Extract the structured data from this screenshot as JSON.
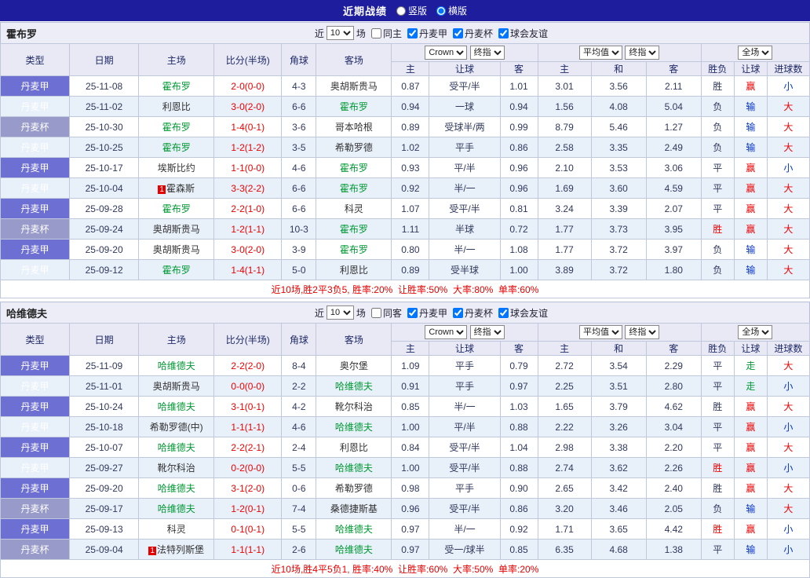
{
  "topbar": {
    "title": "近期战绩",
    "options": [
      {
        "label": "竖版",
        "checked": false
      },
      {
        "label": "横版",
        "checked": true
      }
    ]
  },
  "columns": [
    "类型",
    "日期",
    "主场",
    "比分(半场)",
    "角球",
    "客场",
    "主",
    "让球",
    "客",
    "主",
    "和",
    "客",
    "胜负",
    "让球",
    "进球数"
  ],
  "tables": [
    {
      "team": "霍布罗",
      "filters": {
        "near": "近",
        "count": "10",
        "games": "场",
        "venue": {
          "label": "同主",
          "checked": false
        },
        "comps": [
          {
            "label": "丹麦甲",
            "checked": true
          },
          {
            "label": "丹麦杯",
            "checked": true
          },
          {
            "label": "球会友谊",
            "checked": true
          }
        ]
      },
      "selects": {
        "odds_company": "Crown",
        "odds_time": "终指",
        "euro_company": "平均值",
        "euro_time": "终指",
        "scope": "全场"
      },
      "rows": [
        {
          "type": "丹麦甲",
          "cup": false,
          "date": "25-11-08",
          "home": "霍布罗",
          "hf": true,
          "hb": "",
          "score": "2-0(0-0)",
          "corner": "4-3",
          "away": "奥胡斯贵马",
          "af": false,
          "ab": "",
          "odds": [
            "0.87",
            "受平/半",
            "1.01",
            "3.01",
            "3.56",
            "2.11"
          ],
          "res": "胜",
          "resc": "navy",
          "let": "赢",
          "letc": "red",
          "goal": "小",
          "goalc": "blue"
        },
        {
          "type": "丹麦甲",
          "cup": false,
          "date": "25-11-02",
          "home": "利恩比",
          "hf": false,
          "hb": "",
          "score": "3-0(2-0)",
          "corner": "6-6",
          "away": "霍布罗",
          "af": true,
          "ab": "",
          "odds": [
            "0.94",
            "一球",
            "0.94",
            "1.56",
            "4.08",
            "5.04"
          ],
          "res": "负",
          "resc": "navy",
          "let": "输",
          "letc": "blue",
          "goal": "大",
          "goalc": "red"
        },
        {
          "type": "丹麦杯",
          "cup": true,
          "date": "25-10-30",
          "home": "霍布罗",
          "hf": true,
          "hb": "",
          "score": "1-4(0-1)",
          "corner": "3-6",
          "away": "哥本哈根",
          "af": false,
          "ab": "",
          "odds": [
            "0.89",
            "受球半/两",
            "0.99",
            "8.79",
            "5.46",
            "1.27"
          ],
          "res": "负",
          "resc": "navy",
          "let": "输",
          "letc": "blue",
          "goal": "大",
          "goalc": "red"
        },
        {
          "type": "丹麦甲",
          "cup": false,
          "date": "25-10-25",
          "home": "霍布罗",
          "hf": true,
          "hb": "",
          "score": "1-2(1-2)",
          "corner": "3-5",
          "away": "希勒罗德",
          "af": false,
          "ab": "",
          "odds": [
            "1.02",
            "平手",
            "0.86",
            "2.58",
            "3.35",
            "2.49"
          ],
          "res": "负",
          "resc": "navy",
          "let": "输",
          "letc": "blue",
          "goal": "大",
          "goalc": "red"
        },
        {
          "type": "丹麦甲",
          "cup": false,
          "date": "25-10-17",
          "home": "埃斯比约",
          "hf": false,
          "hb": "",
          "score": "1-1(0-0)",
          "corner": "4-6",
          "away": "霍布罗",
          "af": true,
          "ab": "",
          "odds": [
            "0.93",
            "平/半",
            "0.96",
            "2.10",
            "3.53",
            "3.06"
          ],
          "res": "平",
          "resc": "navy",
          "let": "赢",
          "letc": "red",
          "goal": "小",
          "goalc": "blue"
        },
        {
          "type": "丹麦甲",
          "cup": false,
          "date": "25-10-04",
          "home": "霍森斯",
          "hf": false,
          "hb": "1",
          "score": "3-3(2-2)",
          "corner": "6-6",
          "away": "霍布罗",
          "af": true,
          "ab": "",
          "odds": [
            "0.92",
            "半/一",
            "0.96",
            "1.69",
            "3.60",
            "4.59"
          ],
          "res": "平",
          "resc": "navy",
          "let": "赢",
          "letc": "red",
          "goal": "大",
          "goalc": "red"
        },
        {
          "type": "丹麦甲",
          "cup": false,
          "date": "25-09-28",
          "home": "霍布罗",
          "hf": true,
          "hb": "",
          "score": "2-2(1-0)",
          "corner": "6-6",
          "away": "科灵",
          "af": false,
          "ab": "",
          "odds": [
            "1.07",
            "受平/半",
            "0.81",
            "3.24",
            "3.39",
            "2.07"
          ],
          "res": "平",
          "resc": "navy",
          "let": "赢",
          "letc": "red",
          "goal": "大",
          "goalc": "red"
        },
        {
          "type": "丹麦杯",
          "cup": true,
          "date": "25-09-24",
          "home": "奥胡斯贵马",
          "hf": false,
          "hb": "",
          "score": "1-2(1-1)",
          "corner": "10-3",
          "away": "霍布罗",
          "af": true,
          "ab": "",
          "odds": [
            "1.11",
            "半球",
            "0.72",
            "1.77",
            "3.73",
            "3.95"
          ],
          "res": "胜",
          "resc": "red",
          "let": "赢",
          "letc": "red",
          "goal": "大",
          "goalc": "red"
        },
        {
          "type": "丹麦甲",
          "cup": false,
          "date": "25-09-20",
          "home": "奥胡斯贵马",
          "hf": false,
          "hb": "",
          "score": "3-0(2-0)",
          "corner": "3-9",
          "away": "霍布罗",
          "af": true,
          "ab": "",
          "odds": [
            "0.80",
            "半/一",
            "1.08",
            "1.77",
            "3.72",
            "3.97"
          ],
          "res": "负",
          "resc": "navy",
          "let": "输",
          "letc": "blue",
          "goal": "大",
          "goalc": "red"
        },
        {
          "type": "丹麦甲",
          "cup": false,
          "date": "25-09-12",
          "home": "霍布罗",
          "hf": true,
          "hb": "",
          "score": "1-4(1-1)",
          "corner": "5-0",
          "away": "利恩比",
          "af": false,
          "ab": "",
          "odds": [
            "0.89",
            "受半球",
            "1.00",
            "3.89",
            "3.72",
            "1.80"
          ],
          "res": "负",
          "resc": "navy",
          "let": "输",
          "letc": "blue",
          "goal": "大",
          "goalc": "red"
        }
      ],
      "summary": "近10场,胜2平3负5, 胜率:20%  让胜率:50%  大率:80%  单率:60%"
    },
    {
      "team": "哈维德夫",
      "filters": {
        "near": "近",
        "count": "10",
        "games": "场",
        "venue": {
          "label": "同客",
          "checked": false
        },
        "comps": [
          {
            "label": "丹麦甲",
            "checked": true
          },
          {
            "label": "丹麦杯",
            "checked": true
          },
          {
            "label": "球会友谊",
            "checked": true
          }
        ]
      },
      "selects": {
        "odds_company": "Crown",
        "odds_time": "终指",
        "euro_company": "平均值",
        "euro_time": "终指",
        "scope": "全场"
      },
      "rows": [
        {
          "type": "丹麦甲",
          "cup": false,
          "date": "25-11-09",
          "home": "哈维德夫",
          "hf": true,
          "hb": "",
          "score": "2-2(2-0)",
          "corner": "8-4",
          "away": "奥尔堡",
          "af": false,
          "ab": "",
          "odds": [
            "1.09",
            "平手",
            "0.79",
            "2.72",
            "3.54",
            "2.29"
          ],
          "res": "平",
          "resc": "navy",
          "let": "走",
          "letc": "green",
          "goal": "大",
          "goalc": "red"
        },
        {
          "type": "丹麦甲",
          "cup": false,
          "date": "25-11-01",
          "home": "奥胡斯贵马",
          "hf": false,
          "hb": "",
          "score": "0-0(0-0)",
          "corner": "2-2",
          "away": "哈维德夫",
          "af": true,
          "ab": "",
          "odds": [
            "0.91",
            "平手",
            "0.97",
            "2.25",
            "3.51",
            "2.80"
          ],
          "res": "平",
          "resc": "navy",
          "let": "走",
          "letc": "green",
          "goal": "小",
          "goalc": "blue"
        },
        {
          "type": "丹麦甲",
          "cup": false,
          "date": "25-10-24",
          "home": "哈维德夫",
          "hf": true,
          "hb": "",
          "score": "3-1(0-1)",
          "corner": "4-2",
          "away": "靴尔科治",
          "af": false,
          "ab": "",
          "odds": [
            "0.85",
            "半/一",
            "1.03",
            "1.65",
            "3.79",
            "4.62"
          ],
          "res": "胜",
          "resc": "navy",
          "let": "赢",
          "letc": "red",
          "goal": "大",
          "goalc": "red"
        },
        {
          "type": "丹麦甲",
          "cup": false,
          "date": "25-10-18",
          "home": "希勒罗德(中)",
          "hf": false,
          "hb": "",
          "score": "1-1(1-1)",
          "corner": "4-6",
          "away": "哈维德夫",
          "af": true,
          "ab": "",
          "odds": [
            "1.00",
            "平/半",
            "0.88",
            "2.22",
            "3.26",
            "3.04"
          ],
          "res": "平",
          "resc": "navy",
          "let": "赢",
          "letc": "red",
          "goal": "小",
          "goalc": "blue"
        },
        {
          "type": "丹麦甲",
          "cup": false,
          "date": "25-10-07",
          "home": "哈维德夫",
          "hf": true,
          "hb": "",
          "score": "2-2(2-1)",
          "corner": "2-4",
          "away": "利恩比",
          "af": false,
          "ab": "",
          "odds": [
            "0.84",
            "受平/半",
            "1.04",
            "2.98",
            "3.38",
            "2.20"
          ],
          "res": "平",
          "resc": "navy",
          "let": "赢",
          "letc": "red",
          "goal": "大",
          "goalc": "red"
        },
        {
          "type": "丹麦甲",
          "cup": false,
          "date": "25-09-27",
          "home": "靴尔科治",
          "hf": false,
          "hb": "",
          "score": "0-2(0-0)",
          "corner": "5-5",
          "away": "哈维德夫",
          "af": true,
          "ab": "",
          "odds": [
            "1.00",
            "受平/半",
            "0.88",
            "2.74",
            "3.62",
            "2.26"
          ],
          "res": "胜",
          "resc": "red",
          "let": "赢",
          "letc": "red",
          "goal": "小",
          "goalc": "blue"
        },
        {
          "type": "丹麦甲",
          "cup": false,
          "date": "25-09-20",
          "home": "哈维德夫",
          "hf": true,
          "hb": "",
          "score": "3-1(2-0)",
          "corner": "0-6",
          "away": "希勒罗德",
          "af": false,
          "ab": "",
          "odds": [
            "0.98",
            "平手",
            "0.90",
            "2.65",
            "3.42",
            "2.40"
          ],
          "res": "胜",
          "resc": "navy",
          "let": "赢",
          "letc": "red",
          "goal": "大",
          "goalc": "red"
        },
        {
          "type": "丹麦杯",
          "cup": true,
          "date": "25-09-17",
          "home": "哈维德夫",
          "hf": true,
          "hb": "",
          "score": "1-2(0-1)",
          "corner": "7-4",
          "away": "桑德捷斯基",
          "af": false,
          "ab": "",
          "odds": [
            "0.96",
            "受平/半",
            "0.86",
            "3.20",
            "3.46",
            "2.05"
          ],
          "res": "负",
          "resc": "navy",
          "let": "输",
          "letc": "blue",
          "goal": "大",
          "goalc": "red"
        },
        {
          "type": "丹麦甲",
          "cup": false,
          "date": "25-09-13",
          "home": "科灵",
          "hf": false,
          "hb": "",
          "score": "0-1(0-1)",
          "corner": "5-5",
          "away": "哈维德夫",
          "af": true,
          "ab": "",
          "odds": [
            "0.97",
            "半/一",
            "0.92",
            "1.71",
            "3.65",
            "4.42"
          ],
          "res": "胜",
          "resc": "red",
          "let": "赢",
          "letc": "red",
          "goal": "小",
          "goalc": "blue"
        },
        {
          "type": "丹麦杯",
          "cup": true,
          "date": "25-09-04",
          "home": "法特列斯堡",
          "hf": false,
          "hb": "1",
          "score": "1-1(1-1)",
          "corner": "2-6",
          "away": "哈维德夫",
          "af": true,
          "ab": "",
          "odds": [
            "0.97",
            "受一/球半",
            "0.85",
            "6.35",
            "4.68",
            "1.38"
          ],
          "res": "平",
          "resc": "navy",
          "let": "输",
          "letc": "blue",
          "goal": "小",
          "goalc": "blue"
        }
      ],
      "summary": "近10场,胜4平5负1, 胜率:40%  让胜率:60%  大率:50%  单率:20%"
    }
  ]
}
